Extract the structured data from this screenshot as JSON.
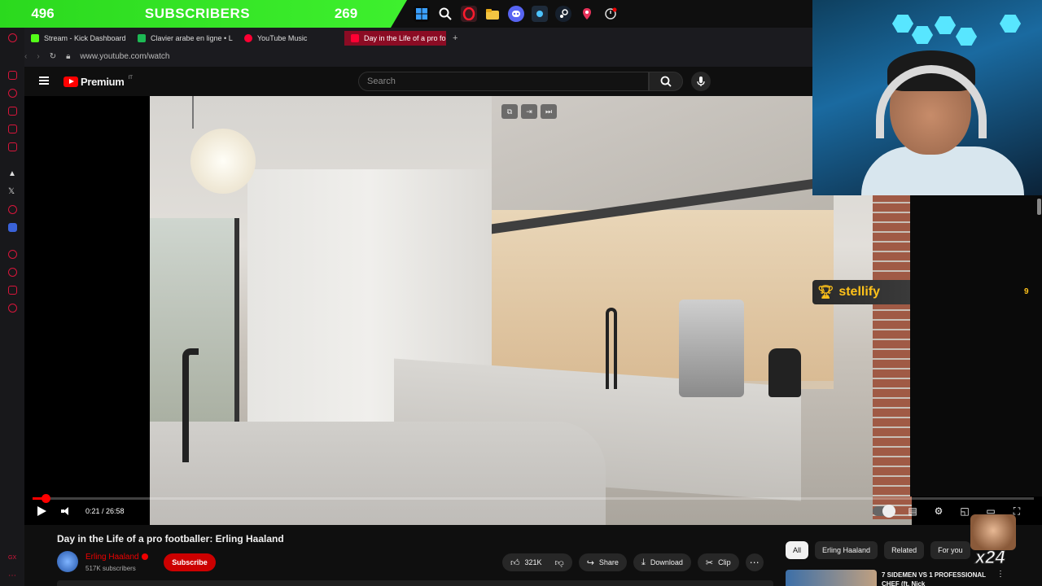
{
  "overlay": {
    "left_count": "496",
    "label": "SUBSCRIBERS",
    "right_count": "269",
    "taskbar_icons": [
      "windows-icon",
      "search-icon",
      "opera-icon",
      "folder-icon",
      "discord-icon",
      "app-icon",
      "steam-icon",
      "maps-pin-icon",
      "clock-icon"
    ]
  },
  "browser": {
    "tabs": [
      {
        "label": "Stream - Kick Dashboard",
        "color": "#53fc18"
      },
      {
        "label": "Clavier arabe en ligne • L",
        "color": "#1db954"
      },
      {
        "label": "YouTube Music",
        "color": "#ff0033"
      },
      {
        "label": "Day in the Life of a pro fo",
        "color": "#ff0033"
      }
    ],
    "new_tab": "+",
    "url": "www.youtube.com/watch",
    "accent": "#d8163b"
  },
  "youtube": {
    "logo_text": "Premium",
    "logo_suffix": "IT",
    "search_placeholder": "Search"
  },
  "player": {
    "time": "0:21 / 26:58",
    "progress_fraction": 0.013
  },
  "stream_overlay": {
    "badge_name": "stellify",
    "badge_count": "9",
    "emote_text": "x24"
  },
  "video_info": {
    "title": "Day in the Life of a pro footballer: Erling Haaland",
    "channel": "Erling Haaland",
    "subscribers": "517K subscribers",
    "subscribe_label": "Subscribe",
    "likes": "321K",
    "share_label": "Share",
    "download_label": "Download",
    "clip_label": "Clip",
    "more": "⋯"
  },
  "chips": [
    "All",
    "Erling Haaland",
    "Related",
    "For you"
  ],
  "recommendation": {
    "title": "7 SIDEMEN VS 1 PROFESSIONAL CHEF (ft. Nick"
  }
}
